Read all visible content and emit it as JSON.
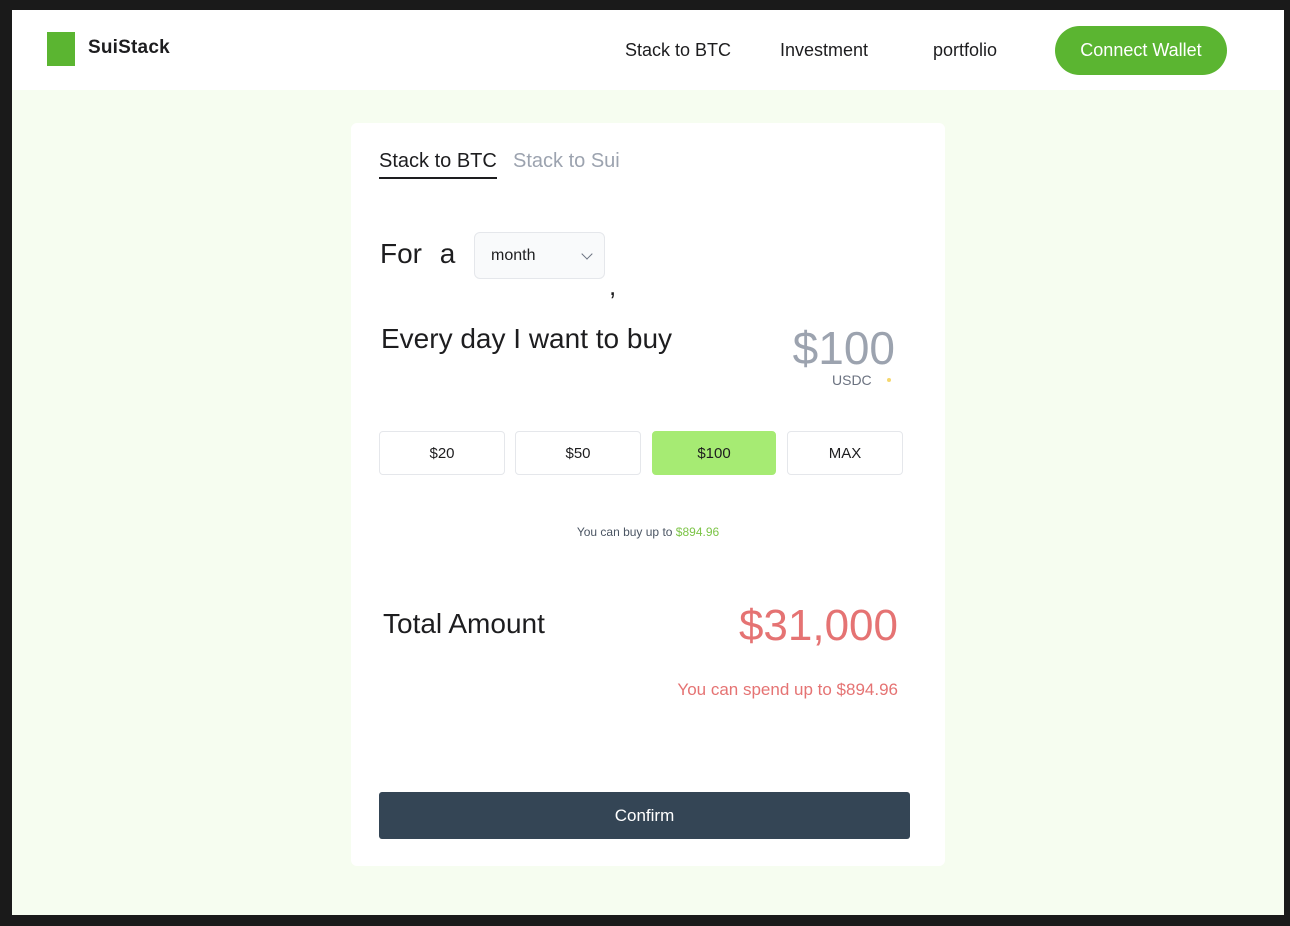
{
  "brand": {
    "name": "SuiStack",
    "accent": "#5bb531"
  },
  "nav": {
    "items": [
      {
        "label": "Stack to BTC"
      },
      {
        "label": "Investment"
      },
      {
        "label": "portfolio"
      }
    ],
    "connect_label": "Connect Wallet"
  },
  "card": {
    "tabs": [
      {
        "label": "Stack to BTC",
        "active": true
      },
      {
        "label": "Stack to Sui",
        "active": false
      }
    ],
    "period": {
      "prefix": "For a",
      "selected": "month",
      "suffix": ","
    },
    "buy": {
      "label": "Every day I want to buy",
      "amount": "$100",
      "unit": "USDC"
    },
    "presets": [
      {
        "label": "$20",
        "selected": false
      },
      {
        "label": "$50",
        "selected": false
      },
      {
        "label": "$100",
        "selected": true
      },
      {
        "label": "MAX",
        "selected": false
      }
    ],
    "hint": {
      "text": "You can buy up to ",
      "amount": "$894.96"
    },
    "total": {
      "label": "Total Amount",
      "value": "$31,000",
      "note": "You can spend up to $894.96"
    },
    "confirm_label": "Confirm"
  },
  "colors": {
    "page_bg": "#f6fdf0",
    "selected_preset": "#a6eb73",
    "total_color": "#e57373",
    "confirm_bg": "#344555"
  }
}
